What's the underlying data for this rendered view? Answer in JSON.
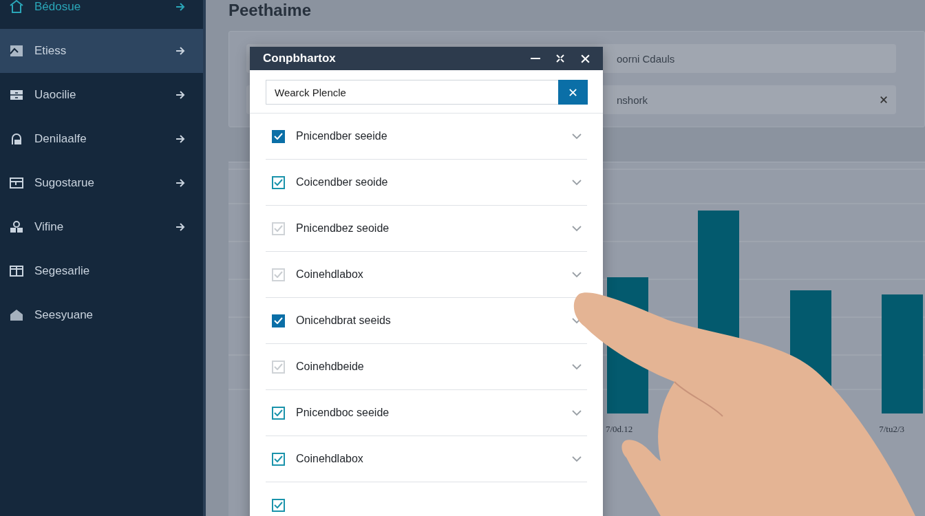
{
  "sidebar": {
    "items": [
      {
        "label": "Bédosue",
        "selected": false,
        "accent": true,
        "arrow": true
      },
      {
        "label": "Etiess",
        "selected": true,
        "accent": false,
        "arrow": true
      },
      {
        "label": "Uaocilie",
        "selected": false,
        "accent": false,
        "arrow": true
      },
      {
        "label": "Denilaalfe",
        "selected": false,
        "accent": false,
        "arrow": true
      },
      {
        "label": "Sugostarue",
        "selected": false,
        "accent": false,
        "arrow": true
      },
      {
        "label": "Vifine",
        "selected": false,
        "accent": false,
        "arrow": true
      },
      {
        "label": "Segesarlie",
        "selected": false,
        "accent": false,
        "arrow": false
      },
      {
        "label": "Seesyuane",
        "selected": false,
        "accent": false,
        "arrow": false
      }
    ]
  },
  "page": {
    "title": "Peethaime"
  },
  "filters": [
    {
      "text": "oorni Cdauls",
      "clear": false
    },
    {
      "text": "nshork",
      "clear": true
    }
  ],
  "chart": {
    "x_labels": [
      "7/0d.12",
      "7/tu2/3"
    ]
  },
  "dialog": {
    "title": "Conpbhartox",
    "search": {
      "value": "Wearck Plencle"
    },
    "items": [
      {
        "label": "Pnicendber seeide",
        "checked": true,
        "kind": "filled"
      },
      {
        "label": "Coicendber seoide",
        "checked": true,
        "kind": "outline"
      },
      {
        "label": "Pnicendbez seoide",
        "checked": false,
        "kind": "outline"
      },
      {
        "label": "Coinehdlabox",
        "checked": false,
        "kind": "outline"
      },
      {
        "label": "Onicehdbrat seeids",
        "checked": true,
        "kind": "filled"
      },
      {
        "label": "Coinehdbeide",
        "checked": false,
        "kind": "outline"
      },
      {
        "label": "Pnicendboc seeide",
        "checked": true,
        "kind": "outline"
      },
      {
        "label": "Coinehdlabox",
        "checked": true,
        "kind": "outline"
      },
      {
        "checked": true,
        "kind": "outline"
      }
    ]
  }
}
